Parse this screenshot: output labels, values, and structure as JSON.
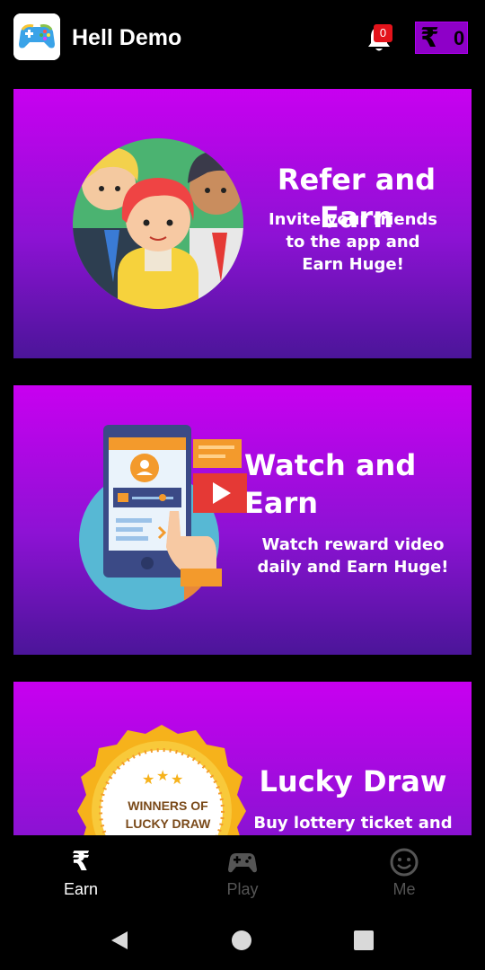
{
  "app": {
    "title": "Hell Demo",
    "logo_icon": "gamepad-icon"
  },
  "header": {
    "notification_count": "0",
    "wallet_symbol": "₹",
    "wallet_balance": "0"
  },
  "cards": [
    {
      "title": "Refer and Earn",
      "description": "Invite your friends to the app and Earn Huge!",
      "illustration": "people-group-icon"
    },
    {
      "title_line1": "Watch and",
      "title_line2": "Earn",
      "description": "Watch reward video daily and Earn Huge!",
      "illustration": "phone-video-icon"
    },
    {
      "title": "Lucky Draw",
      "description": "Buy lottery ticket and",
      "illustration": "badge-icon",
      "badge_line1": "WINNERS OF",
      "badge_line2": "LUCKY DRAW"
    }
  ],
  "bottom_nav": {
    "items": [
      {
        "label": "Earn",
        "icon": "rupee-icon",
        "active": true
      },
      {
        "label": "Play",
        "icon": "gamepad-icon",
        "active": false
      },
      {
        "label": "Me",
        "icon": "smiley-icon",
        "active": false
      }
    ]
  },
  "colors": {
    "card_top": "#c800f0",
    "card_bottom": "#4b1599",
    "wallet_bg": "#8e00c8",
    "badge_red": "#e3131b",
    "nav_active": "#ffffff",
    "nav_inactive": "#555555"
  }
}
